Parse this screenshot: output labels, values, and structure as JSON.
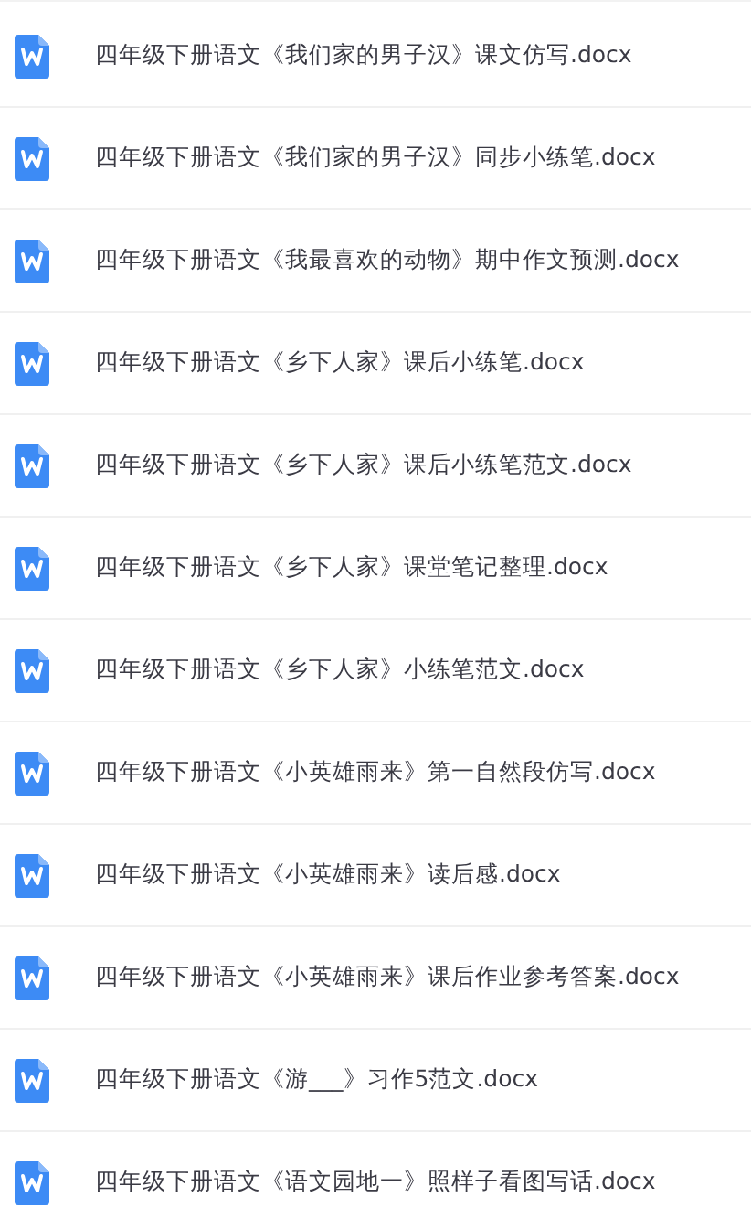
{
  "files": [
    {
      "name": "四年级下册语文《我们家的男子汉》课文仿写.docx"
    },
    {
      "name": "四年级下册语文《我们家的男子汉》同步小练笔.docx"
    },
    {
      "name": "四年级下册语文《我最喜欢的动物》期中作文预测.docx"
    },
    {
      "name": "四年级下册语文《乡下人家》课后小练笔.docx"
    },
    {
      "name": "四年级下册语文《乡下人家》课后小练笔范文.docx"
    },
    {
      "name": "四年级下册语文《乡下人家》课堂笔记整理.docx"
    },
    {
      "name": "四年级下册语文《乡下人家》小练笔范文.docx"
    },
    {
      "name": "四年级下册语文《小英雄雨来》第一自然段仿写.docx"
    },
    {
      "name": "四年级下册语文《小英雄雨来》读后感.docx"
    },
    {
      "name": "四年级下册语文《小英雄雨来》课后作业参考答案.docx"
    },
    {
      "name": "四年级下册语文《游___》习作5范文.docx"
    },
    {
      "name": "四年级下册语文《语文园地一》照样子看图写话.docx"
    }
  ]
}
